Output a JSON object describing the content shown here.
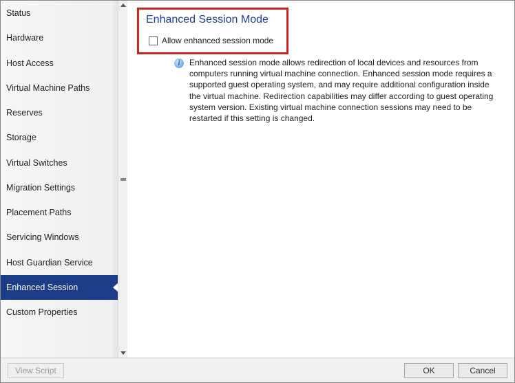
{
  "sidebar": {
    "items": [
      {
        "label": "Status"
      },
      {
        "label": "Hardware"
      },
      {
        "label": "Host Access"
      },
      {
        "label": "Virtual Machine Paths"
      },
      {
        "label": "Reserves"
      },
      {
        "label": "Storage"
      },
      {
        "label": "Virtual Switches"
      },
      {
        "label": "Migration Settings"
      },
      {
        "label": "Placement Paths"
      },
      {
        "label": "Servicing Windows"
      },
      {
        "label": "Host Guardian Service"
      },
      {
        "label": "Enhanced Session"
      },
      {
        "label": "Custom Properties"
      }
    ],
    "selected_index": 11
  },
  "content": {
    "title": "Enhanced Session Mode",
    "checkbox_label": "Allow enhanced session mode",
    "checkbox_checked": false,
    "info_text": "Enhanced session mode allows redirection of local devices and resources from computers running virtual machine connection. Enhanced session mode requires a supported guest operating system, and may require additional configuration inside the virtual machine. Redirection capabilities may differ according to guest operating system version. Existing virtual machine connection sessions may need to be restarted if this setting is changed."
  },
  "footer": {
    "view_script": "View Script",
    "ok": "OK",
    "cancel": "Cancel"
  }
}
